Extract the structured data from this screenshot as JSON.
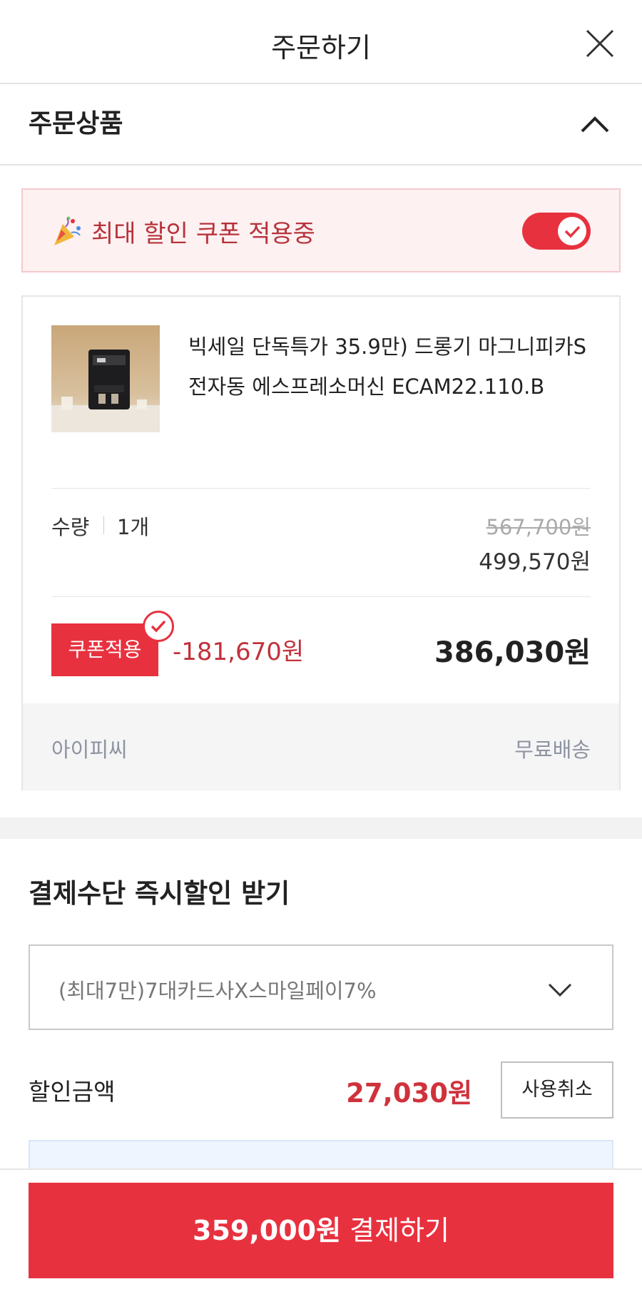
{
  "header": {
    "title": "주문하기",
    "close_icon": "close-icon"
  },
  "order_section": {
    "title": "주문상품",
    "collapse_icon": "chevron-up-icon"
  },
  "coupon_banner": {
    "text": "최대 할인 쿠폰 적용중",
    "icon": "party-popper-icon",
    "toggle_on": true,
    "accent_color": "#e8313f"
  },
  "product": {
    "name": "빅세일 단독특가 35.9만) 드롱기 마그니피카S 전자동 에스프레소머신 ECAM22.110.B",
    "quantity_label": "수량",
    "quantity_value": "1개",
    "original_price": "567,700원",
    "sale_price": "499,570원",
    "coupon_button": "쿠폰적용",
    "discount_amount": "-181,670원",
    "final_price": "386,030원",
    "seller": "아이피씨",
    "shipping": "무료배송"
  },
  "payment": {
    "title": "결제수단 즉시할인 받기",
    "selected_option": "(최대7만)7대카드사X스마일페이7%",
    "discount_label": "할인금액",
    "discount_value": "27,030원",
    "cancel_button": "사용취소"
  },
  "footer": {
    "pay_amount": "359,000원",
    "pay_label": "결제하기"
  }
}
